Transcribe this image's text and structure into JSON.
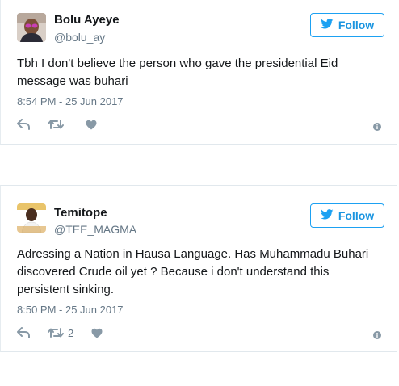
{
  "tweets": [
    {
      "name": "Bolu Ayeye",
      "handle": "@bolu_ay",
      "follow_label": "Follow",
      "text": "Tbh I don't believe the person who gave the presidential Eid message was buhari",
      "timestamp": "8:54 PM - 25 Jun 2017",
      "retweet_count": ""
    },
    {
      "name": "Temitope",
      "handle": "@TEE_MAGMA",
      "follow_label": "Follow",
      "text": "Adressing a Nation in Hausa Language. Has Muhammadu Buhari discovered Crude oil yet ? Because i don't understand this persistent sinking.",
      "timestamp": "8:50 PM - 25 Jun 2017",
      "retweet_count": "2"
    }
  ],
  "colors": {
    "accent": "#1da1f2",
    "follow_text": "#1b95e0",
    "secondary_text": "#657786",
    "icon_gray": "#8899a6",
    "border": "#e1e8ed"
  },
  "icons": [
    "twitter-bird-icon",
    "reply-icon",
    "retweet-icon",
    "like-heart-icon",
    "info-icon"
  ]
}
